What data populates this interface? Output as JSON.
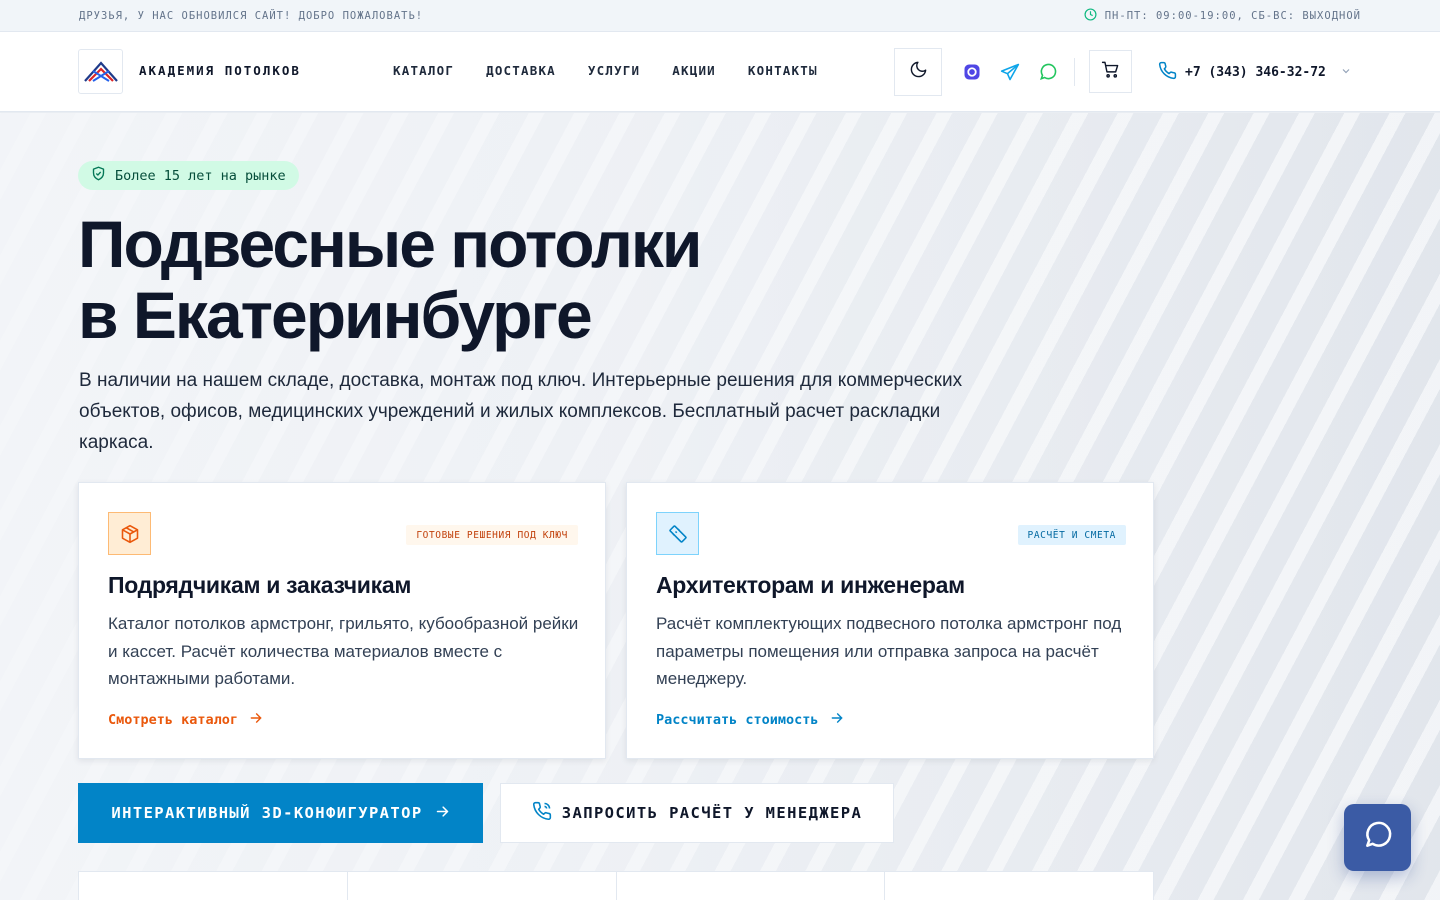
{
  "topbar": {
    "announcement": "ДРУЗЬЯ, У НАС ОБНОВИЛСЯ САЙТ! ДОБРО ПОЖАЛОВАТЬ!",
    "hours": "ПН-ПТ: 09:00-19:00, СБ-ВС: ВЫХОДНОЙ",
    "clock_icon": "clock-icon"
  },
  "header": {
    "logo_text": "АКАДЕМИЯ ПОТОЛКОВ",
    "nav": [
      "КАТАЛОГ",
      "ДОСТАВКА",
      "УСЛУГИ",
      "АКЦИИ",
      "КОНТАКТЫ"
    ],
    "phone": "+7 (343) 346-32-72",
    "icons": [
      "moon-icon",
      "max-messenger-icon",
      "telegram-icon",
      "whatsapp-icon",
      "cart-icon",
      "phone-icon",
      "chevron-down-icon"
    ]
  },
  "hero": {
    "badge": "Более 15 лет на рынке",
    "title_line1": "Подвесные потолки",
    "title_line2": "в Екатеринбурге",
    "lead": "В наличии на нашем складе, доставка, монтаж под ключ. Интерьерные решения для коммерческих объектов, офисов, медицинских учреждений и жилых комплексов. Бесплатный расчет раскладки каркаса."
  },
  "cards": [
    {
      "icon": "package-icon",
      "tag": "ГОТОВЫЕ РЕШЕНИЯ ПОД КЛЮЧ",
      "title": "Подрядчикам и заказчикам",
      "text": "Каталог потолков армстронг, грильято, кубообразной рейки и кассет. Расчёт количества материалов вместе с монтажными работами.",
      "link": "Смотреть каталог"
    },
    {
      "icon": "ruler-icon",
      "tag": "РАСЧЁТ И СМЕТА",
      "title": "Архитекторам и инженерам",
      "text": "Расчёт комплектующих подвесного потолка армстронг под параметры помещения или отправка запроса на расчёт менеджеру.",
      "link": "Рассчитать стоимость"
    }
  ],
  "buttons": {
    "configurator": "ИНТЕРАКТИВНЫЙ 3D-КОНФИГУРАТОР",
    "request": "ЗАПРОСИТЬ РАСЧЁТ У МЕНЕДЖЕРА"
  },
  "colors": {
    "accent_blue": "#0284c7",
    "accent_orange": "#ea580c",
    "badge_green": "#d1fae5",
    "chat_button": "#3b5ba5"
  }
}
